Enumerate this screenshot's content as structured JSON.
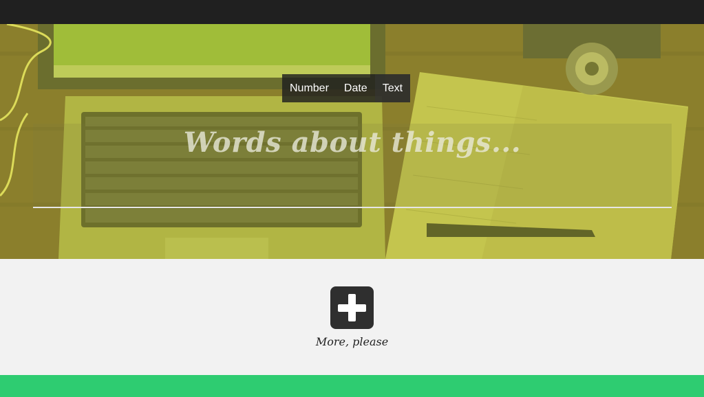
{
  "type_switch": {
    "options": [
      "Number",
      "Date",
      "Text"
    ],
    "selected": "Text"
  },
  "editor": {
    "placeholder": "Words about things..."
  },
  "add": {
    "label": "More, please",
    "icon": "plus-icon"
  },
  "colors": {
    "topbar": "#202020",
    "accent_bar": "#2ecc71",
    "page_background": "#f2f2f2",
    "add_button": "#2f2f2f"
  }
}
